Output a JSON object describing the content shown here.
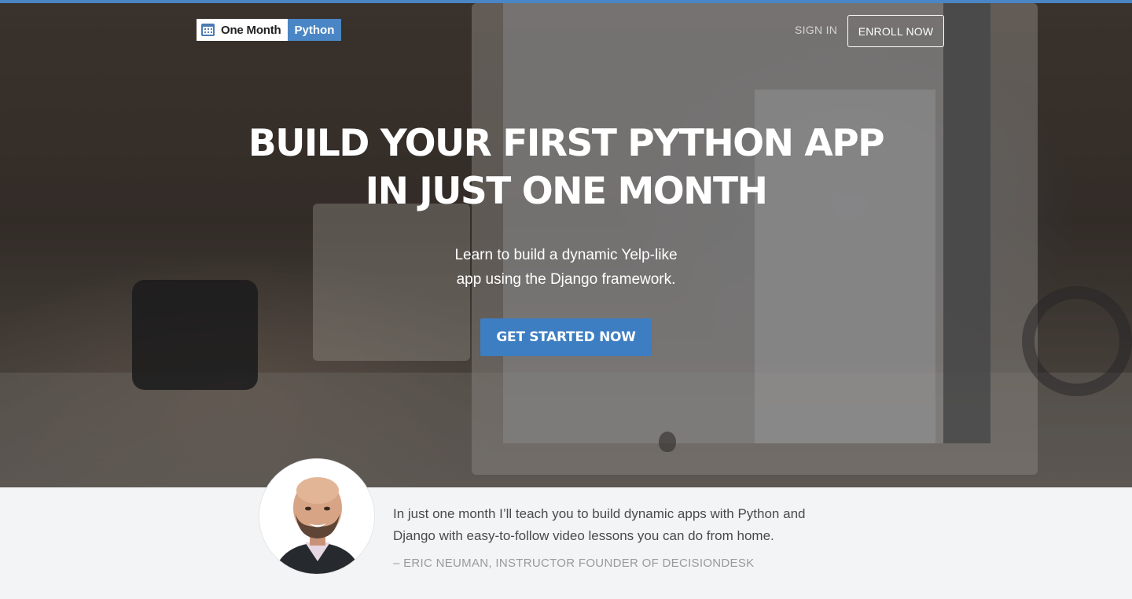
{
  "header": {
    "logo_primary": "One Month",
    "logo_secondary": "Python",
    "sign_in": "SIGN IN",
    "enroll": "ENROLL NOW"
  },
  "hero": {
    "title_line1": "BUILD YOUR FIRST PYTHON APP",
    "title_line2": "IN JUST ONE MONTH",
    "subtitle_line1": "Learn to build a dynamic Yelp-like",
    "subtitle_line2": "app using the Django framework.",
    "cta": "GET STARTED NOW"
  },
  "testimonial": {
    "quote": "In just one month I’ll teach you to build dynamic apps with Python and Django with easy-to-follow video lessons you can do from home.",
    "author": "– ERIC NEUMAN, INSTRUCTOR FOUNDER OF DECISIONDESK"
  },
  "colors": {
    "accent": "#3d7ec2",
    "top_bar": "#4a86c5",
    "hero_overlay": "#2a231e",
    "testimonial_bg": "#f3f4f6"
  },
  "icons": {
    "logo": "calendar-icon"
  }
}
